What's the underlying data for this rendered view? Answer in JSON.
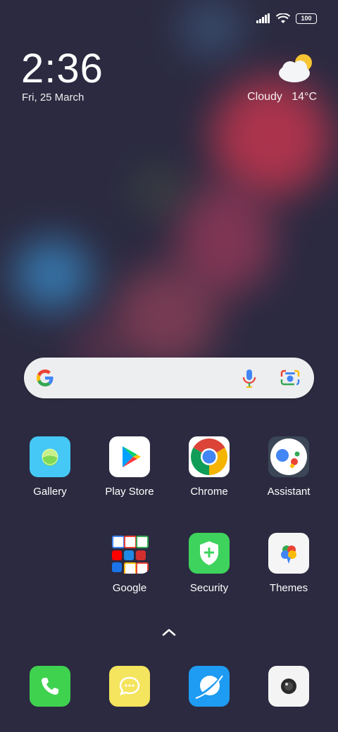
{
  "status": {
    "battery_level": "100",
    "signal_icon": "cellular-signal-icon",
    "wifi_icon": "wifi-icon"
  },
  "clock": {
    "time": "2:36",
    "date": "Fri, 25 March"
  },
  "weather": {
    "condition": "Cloudy",
    "temperature": "14°C",
    "icon": "partly-cloudy-icon"
  },
  "search": {
    "google_icon": "google-g-icon",
    "mic_icon": "microphone-icon",
    "lens_icon": "google-lens-icon"
  },
  "apps_row1": [
    {
      "label": "Gallery",
      "icon": "gallery-icon"
    },
    {
      "label": "Play Store",
      "icon": "play-store-icon"
    },
    {
      "label": "Chrome",
      "icon": "chrome-icon"
    },
    {
      "label": "Assistant",
      "icon": "assistant-icon"
    }
  ],
  "apps_row2": [
    {
      "label": "Google",
      "icon": "google-folder-icon"
    },
    {
      "label": "Security",
      "icon": "security-icon"
    },
    {
      "label": "Themes",
      "icon": "themes-icon"
    }
  ],
  "dock": [
    {
      "icon": "phone-icon"
    },
    {
      "icon": "messaging-icon"
    },
    {
      "icon": "browser-icon"
    },
    {
      "icon": "camera-icon"
    }
  ],
  "colors": {
    "background": "#2b2a40",
    "gallery": "#45c8f5",
    "security": "#3ed35c",
    "phone": "#3fd24f",
    "messaging": "#f4e45e",
    "browser": "#1e9bf2"
  }
}
